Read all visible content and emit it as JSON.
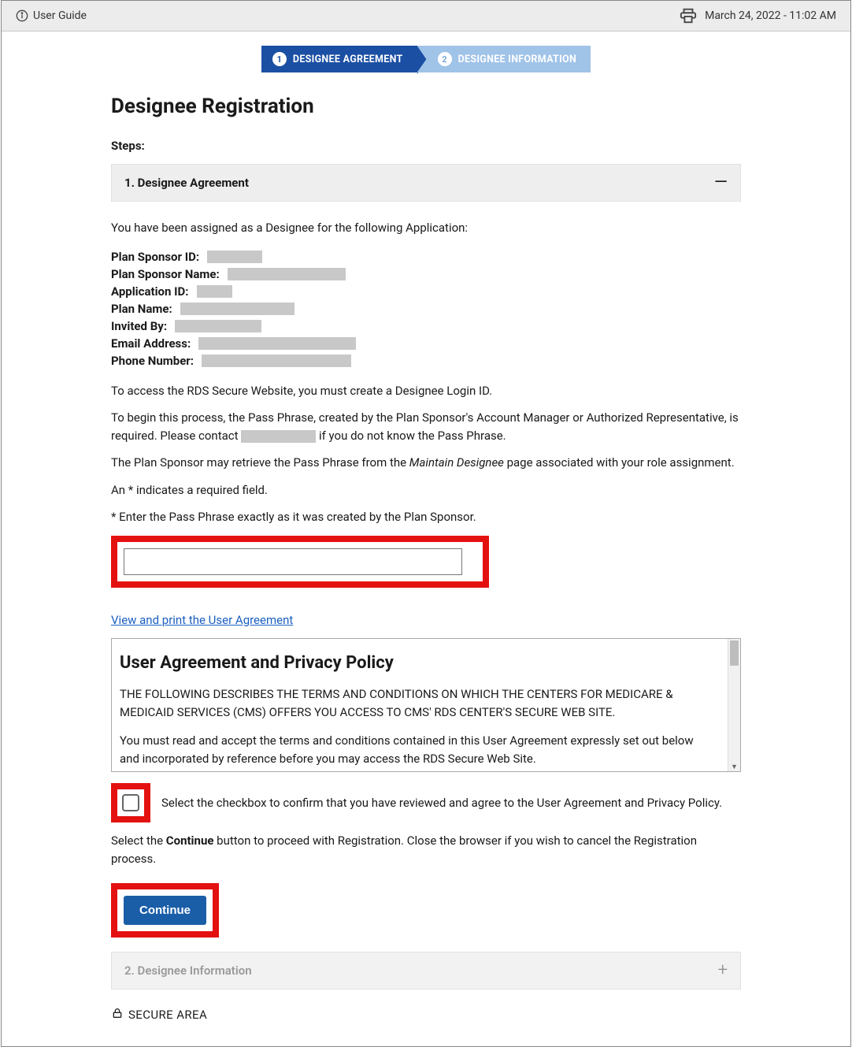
{
  "topbar": {
    "user_guide": "User Guide",
    "timestamp": "March 24, 2022 - 11:02 AM"
  },
  "stepper": {
    "step1": {
      "num": "1",
      "label": "DESIGNEE AGREEMENT"
    },
    "step2": {
      "num": "2",
      "label": "DESIGNEE INFORMATION"
    }
  },
  "page": {
    "title": "Designee Registration",
    "steps_label": "Steps:"
  },
  "acc1": {
    "title": "1. Designee Agreement"
  },
  "intro": "You have been assigned as a Designee for the following Application:",
  "fields": {
    "plan_sponsor_id": "Plan Sponsor ID:",
    "plan_sponsor_name": "Plan Sponsor Name:",
    "application_id": "Application ID:",
    "plan_name": "Plan Name:",
    "invited_by": "Invited By:",
    "email": "Email Address:",
    "phone": "Phone Number:"
  },
  "para": {
    "access": "To access the RDS Secure Website, you must create a Designee Login ID.",
    "begin_a": "To begin this process, the Pass Phrase, created by the Plan Sponsor's Account Manager or Authorized Representative, is required. Please contact ",
    "begin_b": " if you do not know the Pass Phrase.",
    "retrieve_a": "The Plan Sponsor may retrieve the Pass Phrase from the ",
    "retrieve_i": "Maintain Designee",
    "retrieve_b": " page associated with your role assignment.",
    "required": "An * indicates a required field.",
    "enter": "* Enter the Pass Phrase exactly as it was created by the Plan Sponsor."
  },
  "link_ua": "View and print the User Agreement",
  "ua": {
    "heading": "User Agreement and Privacy Policy",
    "p1": "THE FOLLOWING DESCRIBES THE TERMS AND CONDITIONS ON WHICH THE CENTERS FOR MEDICARE & MEDICAID SERVICES (CMS) OFFERS YOU ACCESS TO CMS' RDS CENTER'S SECURE WEB SITE.",
    "p2": "You must read and accept the terms and conditions contained in this User Agreement expressly set out below and incorporated by reference before you may access the RDS Secure Web Site."
  },
  "confirm": {
    "label": "Select the checkbox to confirm that you have reviewed and agree to the User Agreement and Privacy Policy.",
    "cont_a": "Select the ",
    "cont_b": "Continue",
    "cont_c": " button to proceed with Registration. Close the browser if you wish to cancel the Registration process."
  },
  "button": {
    "continue": "Continue"
  },
  "acc2": {
    "title": "2. Designee Information"
  },
  "secure": "SECURE AREA"
}
